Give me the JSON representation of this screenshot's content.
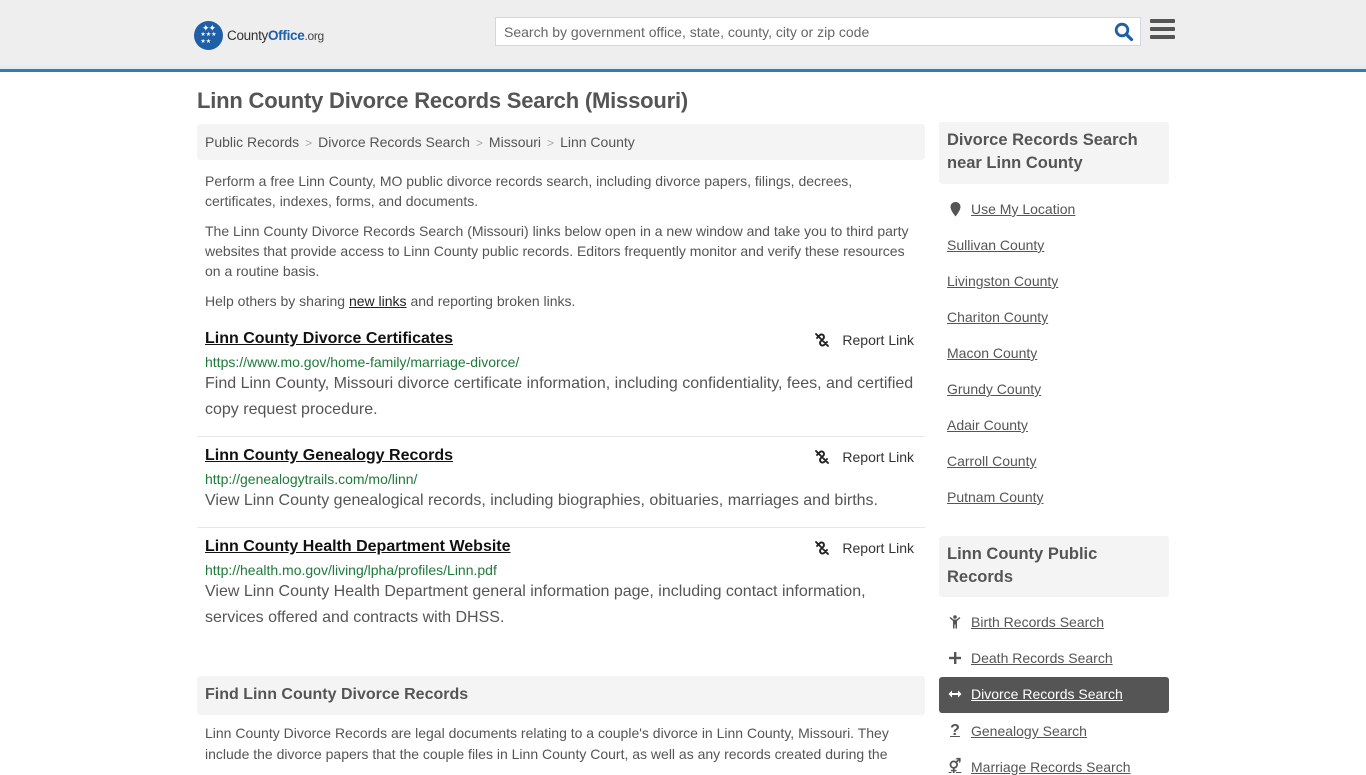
{
  "header": {
    "logo": {
      "part1": "County",
      "part2": "Office",
      "part3": ".org"
    },
    "search_placeholder": "Search by government office, state, county, city or zip code",
    "search_icon": "search-icon",
    "menu_icon": "hamburger-menu-icon",
    "accent_color": "#3a7bad"
  },
  "page": {
    "title": "Linn County Divorce Records Search (Missouri)",
    "breadcrumb": [
      "Public Records",
      "Divorce Records Search",
      "Missouri",
      "Linn County"
    ],
    "intro": {
      "p1": "Perform a free Linn County, MO public divorce records search, including divorce papers, filings, decrees, certificates, indexes, forms, and documents.",
      "p2": "The Linn County Divorce Records Search (Missouri) links below open in a new window and take you to third party websites that provide access to Linn County public records. Editors frequently monitor and verify these resources on a routine basis.",
      "p3_before": "Help others by sharing ",
      "p3_link": "new links",
      "p3_after": " and reporting broken links."
    },
    "results": [
      {
        "title": "Linn County Divorce Certificates",
        "url": "https://www.mo.gov/home-family/marriage-divorce/",
        "description": "Find Linn County, Missouri divorce certificate information, including confidentiality, fees, and certified copy request procedure.",
        "report_label": "Report Link"
      },
      {
        "title": "Linn County Genealogy Records",
        "url": "http://genealogytrails.com/mo/linn/",
        "description": "View Linn County genealogical records, including biographies, obituaries, marriages and births.",
        "report_label": "Report Link"
      },
      {
        "title": "Linn County Health Department Website",
        "url": "http://health.mo.gov/living/lpha/profiles/Linn.pdf",
        "description": "View Linn County Health Department general information page, including contact information, services offered and contracts with DHSS.",
        "report_label": "Report Link"
      }
    ],
    "section": {
      "heading": "Find Linn County Divorce Records",
      "body": "Linn County Divorce Records are legal documents relating to a couple's divorce in Linn County, Missouri. They include the divorce papers that the couple files in Linn County Court, as well as any records created during the"
    }
  },
  "sidebar": {
    "nearby": {
      "heading": "Divorce Records Search near Linn County",
      "use_location": "Use My Location",
      "counties": [
        "Sullivan County",
        "Livingston County",
        "Chariton County",
        "Macon County",
        "Grundy County",
        "Adair County",
        "Carroll County",
        "Putnam County"
      ]
    },
    "public_records": {
      "heading": "Linn County Public Records",
      "items": [
        {
          "label": "Birth Records Search",
          "icon": "child-icon",
          "active": false
        },
        {
          "label": "Death Records Search",
          "icon": "plus-icon",
          "active": false
        },
        {
          "label": "Divorce Records Search",
          "icon": "arrows-horizontal-icon",
          "active": true
        },
        {
          "label": "Genealogy Search",
          "icon": "question-icon",
          "active": false
        },
        {
          "label": "Marriage Records Search",
          "icon": "gender-icon",
          "active": false
        }
      ]
    }
  }
}
